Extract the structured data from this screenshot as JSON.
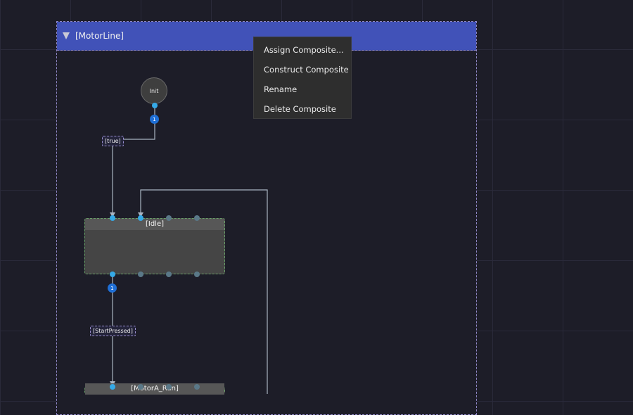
{
  "composite": {
    "title": "[MotorLine]"
  },
  "init_node": {
    "label": "Init"
  },
  "badges": [
    "1",
    "1"
  ],
  "conditions": [
    "[true]",
    "[StartPressed]"
  ],
  "states": [
    {
      "title": "[Idle]"
    },
    {
      "title": "[MotorA_Run]"
    }
  ],
  "context_menu": {
    "items": [
      "Assign Composite...",
      "Construct Composite",
      "Rename",
      "Delete Composite"
    ]
  },
  "icons": {
    "collapse": "collapse-triangle-icon"
  },
  "colors": {
    "header": "#4152b8",
    "badge": "#1f6fd6",
    "port_active": "#35a9e6",
    "state_border": "#67a067",
    "composite_border": "#8e86c4"
  }
}
